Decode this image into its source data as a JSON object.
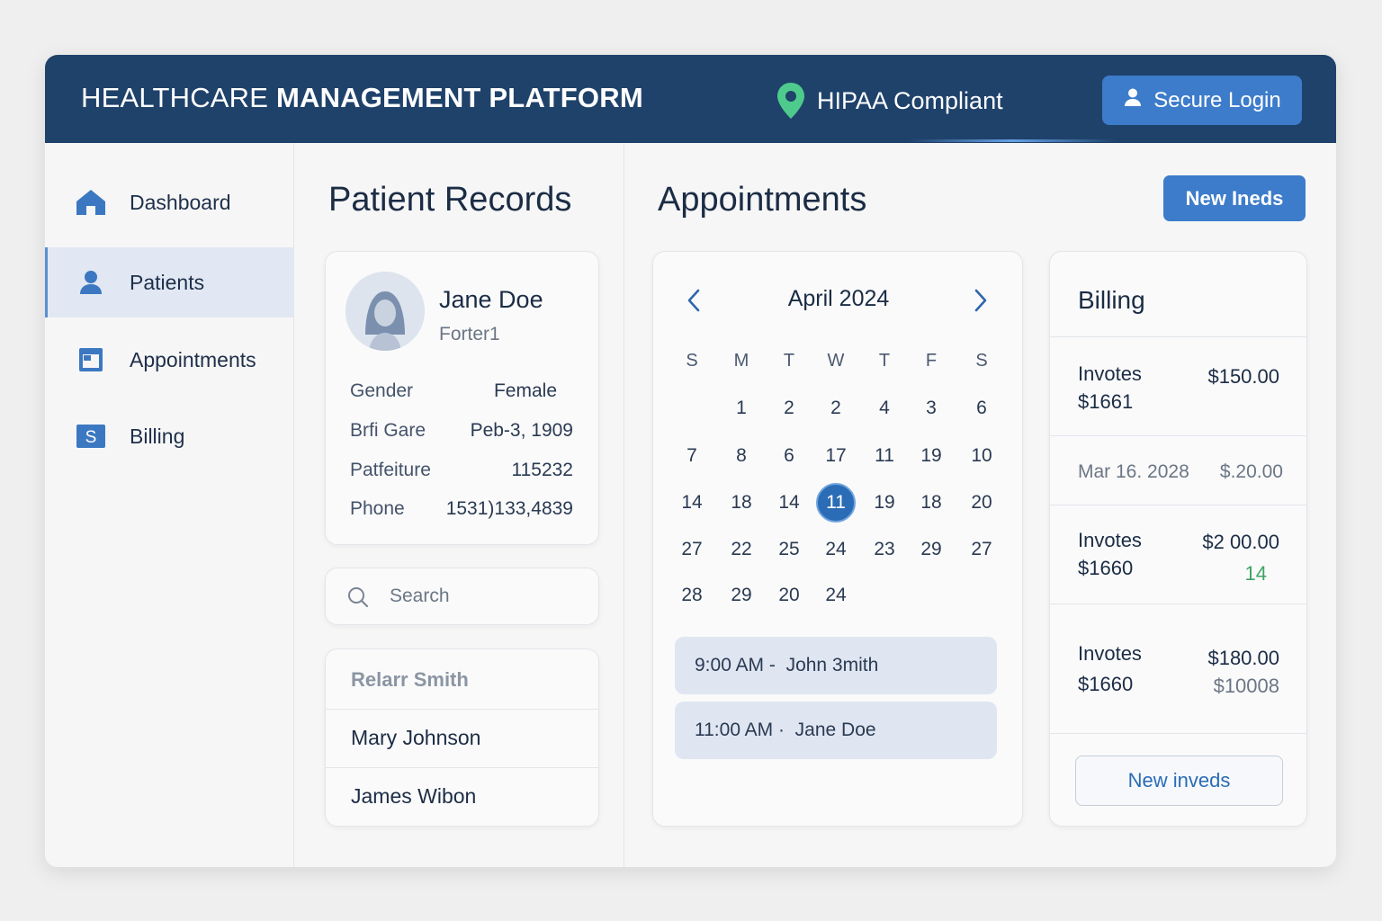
{
  "header": {
    "brand_light": "HEALTHCARE ",
    "brand_bold": "MANAGEMENT PLATFORM",
    "compliance": "HIPAA Compliant",
    "login_label": "Secure Login",
    "colors": {
      "bar": "#1f426b",
      "accent": "#3d7ccb",
      "pin": "#4ecb8c"
    }
  },
  "sidebar": {
    "items": [
      {
        "label": "Dashboard",
        "icon": "home-icon",
        "active": false
      },
      {
        "label": "Patients",
        "icon": "user-icon",
        "active": true
      },
      {
        "label": "Appointments",
        "icon": "calendar-icon",
        "active": false
      },
      {
        "label": "Billing",
        "icon": "dollar-icon",
        "active": false
      }
    ]
  },
  "patients": {
    "title": "Patient Records",
    "profile": {
      "name": "Jane Doe",
      "subtitle": "Forter1",
      "fields": [
        {
          "label": "Gender",
          "value": "Female"
        },
        {
          "label": "Brfi Gare",
          "value": "Peb-3, 1909"
        },
        {
          "label": "Patfeiture",
          "value": "115232"
        },
        {
          "label": "Phone",
          "value": "1531)133,4839"
        }
      ]
    },
    "search_placeholder": "Search",
    "list": [
      "Relarr Smith",
      "Mary Johnson",
      "James Wibon"
    ]
  },
  "appointments": {
    "title": "Appointments",
    "new_button": "New Ineds",
    "calendar": {
      "month": "April 2024",
      "weekdays": [
        "S",
        "M",
        "T",
        "W",
        "T",
        "F",
        "S"
      ],
      "weeks": [
        [
          "",
          "1",
          "2",
          "2",
          "4",
          "3",
          "6"
        ],
        [
          "7",
          "8",
          "6",
          "17",
          "11",
          "19",
          "10"
        ],
        [
          "14",
          "18",
          "14",
          "11",
          "19",
          "18",
          "20"
        ],
        [
          "27",
          "22",
          "25",
          "24",
          "23",
          "29",
          "27"
        ],
        [
          "28",
          "29",
          "20",
          "24",
          "",
          "",
          ""
        ]
      ],
      "selected": {
        "week": 2,
        "day": 3
      }
    },
    "slots": [
      {
        "time": "9:00 AM",
        "sep": " -  ",
        "name": "John 3mith"
      },
      {
        "time": "11:00 AM",
        "sep": " ·  ",
        "name": "Jane Doe"
      }
    ]
  },
  "billing": {
    "title": "Billing",
    "rows": [
      {
        "title": "Invotes",
        "sub": "$1661",
        "amount": "$150.00",
        "amount2": ""
      },
      {
        "title": "Mar 16. 2028",
        "sub": "",
        "amount": "$.20.00",
        "amount2": ""
      },
      {
        "title": "Invotes",
        "sub": "$1660",
        "amount": "$2 00.00",
        "amount2": "14"
      },
      {
        "title": "Invotes",
        "sub": "$1660",
        "amount": "$180.00",
        "amount2": "$10008"
      }
    ],
    "new_button": "New inveds"
  }
}
